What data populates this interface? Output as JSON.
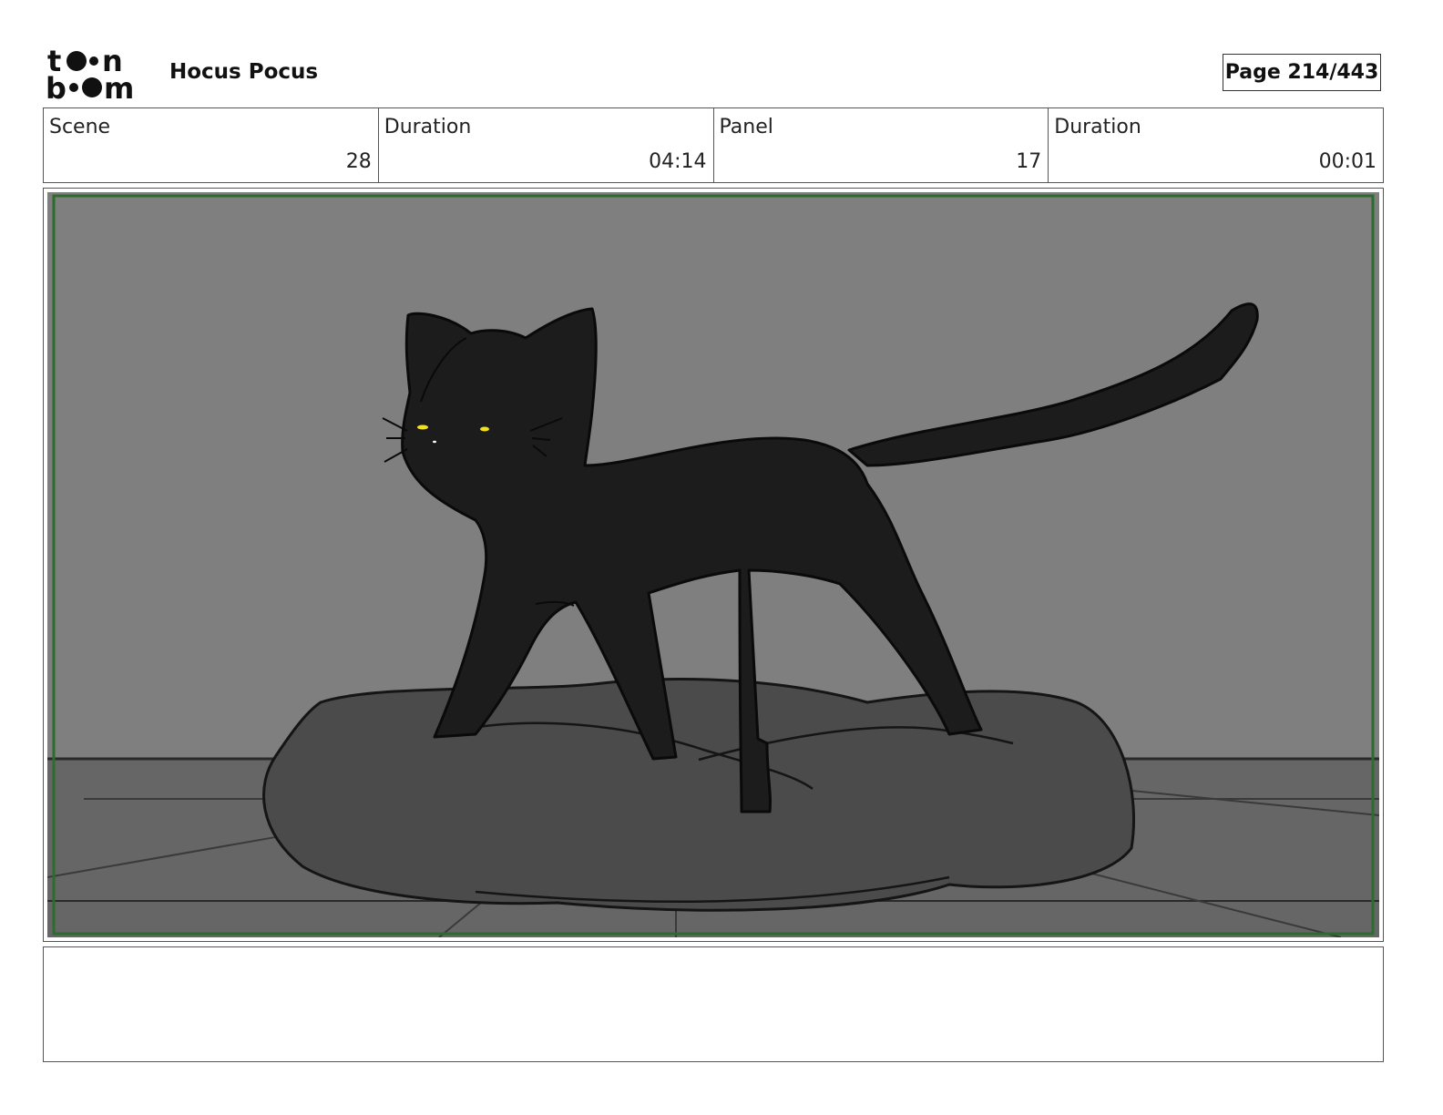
{
  "header": {
    "logo_alt": "toon boom",
    "project_title": "Hocus Pocus",
    "page_label": "Page 214/443"
  },
  "info": {
    "scene_label": "Scene",
    "scene_value": "28",
    "scene_duration_label": "Duration",
    "scene_duration_value": "04:14",
    "panel_label": "Panel",
    "panel_value": "17",
    "panel_duration_label": "Duration",
    "panel_duration_value": "00:01"
  },
  "panel": {
    "frame_color": "#2e6b2e",
    "wall_color": "#7f7f7f",
    "floor_color": "#666666",
    "cushion_color": "#4b4b4b",
    "cat_color": "#1c1c1c",
    "eye_color": "#f2e21a"
  },
  "notes": {
    "text": ""
  }
}
